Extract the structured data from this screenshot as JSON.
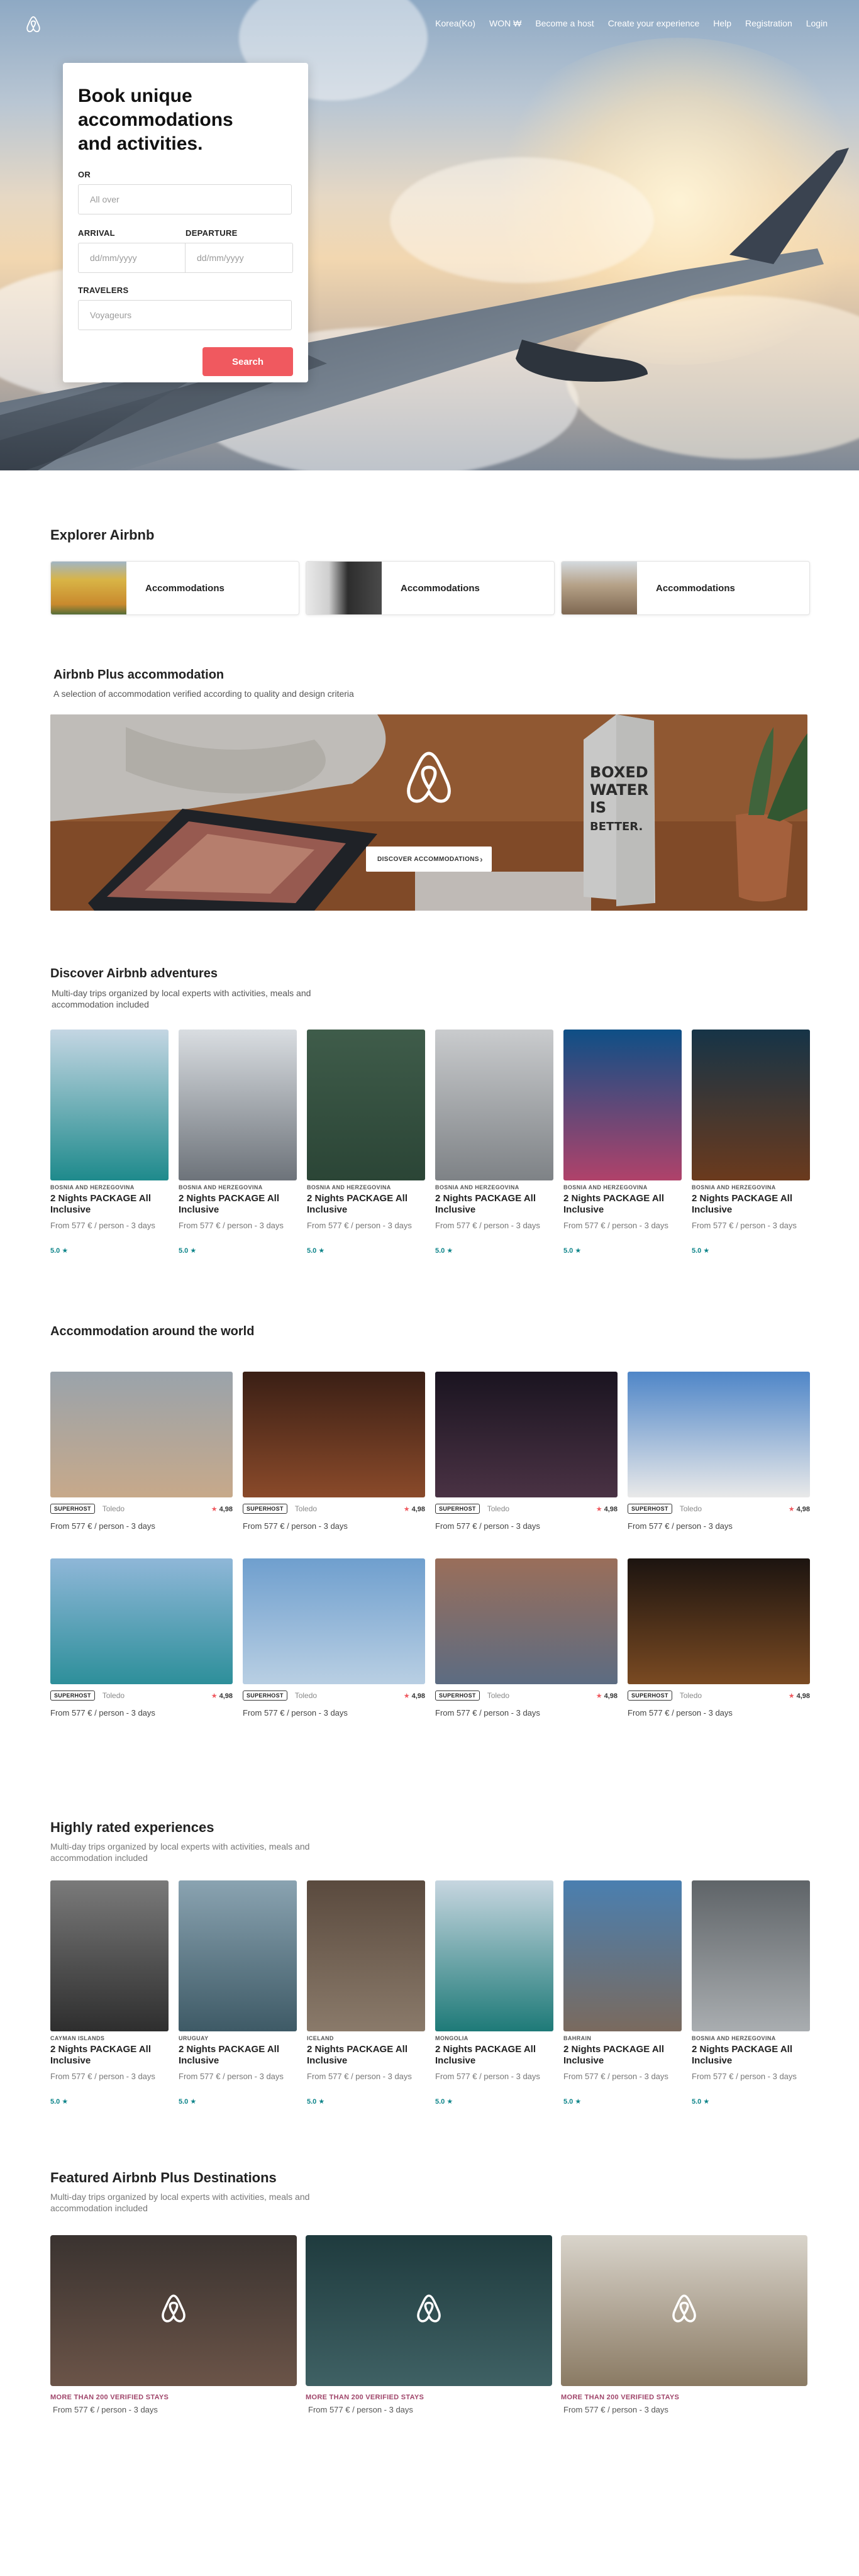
{
  "nav": {
    "language": "Korea(Ko)",
    "currency": "WON ₩",
    "links": [
      "Become a host",
      "Create your experience",
      "Help",
      "Registration",
      "Login"
    ]
  },
  "booking": {
    "title": "Book unique accommodations and activities.",
    "where_label": "OR",
    "where_placeholder": "All over",
    "arrival_label": "ARRIVAL",
    "departure_label": "DEPARTURE",
    "arrival_placeholder": "dd/mm/yyyy",
    "departure_placeholder": "dd/mm/yyyy",
    "travelers_label": "TRAVELERS",
    "travelers_placeholder": "Voyageurs",
    "search_label": "Search"
  },
  "explore": {
    "title": "Explorer Airbnb",
    "cards": [
      {
        "label": "Accommodations",
        "color": "#c9a84d"
      },
      {
        "label": "Accommodations",
        "color": "#3b3b3b"
      },
      {
        "label": "Accommodations",
        "color": "#a0856a"
      }
    ]
  },
  "plus": {
    "title": "Airbnb Plus accommodation",
    "subtitle": "A selection of accommodation verified according to quality and design criteria",
    "button": "DISCOVER ACCOMMODATIONS",
    "carton_text": [
      "BOXED",
      "WATER",
      "IS",
      "BETTER."
    ]
  },
  "adventures": {
    "title": "Discover Airbnb adventures",
    "subtitle": "Multi-day trips organized by local experts with activities, meals and accommodation included",
    "cards": [
      {
        "country": "BOSNIA AND HERZEGOVINA",
        "title": "2 Nights PACKAGE All Inclusive",
        "price": "From 577 € / person - 3 days",
        "rating": "5.0 ★",
        "top": "#c4d6e3",
        "bottom": "#1e8a8c"
      },
      {
        "country": "BOSNIA AND HERZEGOVINA",
        "title": "2 Nights PACKAGE All Inclusive",
        "price": "From 577 € / person - 3 days",
        "rating": "5.0 ★",
        "top": "#d9dde1",
        "bottom": "#6d737a"
      },
      {
        "country": "BOSNIA AND HERZEGOVINA",
        "title": "2 Nights PACKAGE All Inclusive",
        "price": "From 577 € / person - 3 days",
        "rating": "5.0 ★",
        "top": "#3f5c4a",
        "bottom": "#2b4536"
      },
      {
        "country": "BOSNIA AND HERZEGOVINA",
        "title": "2 Nights PACKAGE All Inclusive",
        "price": "From 577 € / person - 3 days",
        "rating": "5.0 ★",
        "top": "#c9cbcd",
        "bottom": "#7e8286"
      },
      {
        "country": "BOSNIA AND HERZEGOVINA",
        "title": "2 Nights PACKAGE All Inclusive",
        "price": "From 577 € / person - 3 days",
        "rating": "5.0 ★",
        "top": "#0e4f86",
        "bottom": "#b0426a"
      },
      {
        "country": "BOSNIA AND HERZEGOVINA",
        "title": "2 Nights PACKAGE All Inclusive",
        "price": "From 577 € / person - 3 days",
        "rating": "5.0 ★",
        "top": "#163447",
        "bottom": "#6b3a1d"
      }
    ]
  },
  "world": {
    "title": "Accommodation around the world",
    "cards": [
      {
        "badge": "SUPERHOST",
        "city": "Toledo",
        "score": "4,98",
        "price": "From 577 € / person - 3 days",
        "top": "#9aa3ab",
        "bottom": "#c7a98a"
      },
      {
        "badge": "SUPERHOST",
        "city": "Toledo",
        "score": "4,98",
        "price": "From 577 € / person - 3 days",
        "top": "#3a1f15",
        "bottom": "#8a4a2a"
      },
      {
        "badge": "SUPERHOST",
        "city": "Toledo",
        "score": "4,98",
        "price": "From 577 € / person - 3 days",
        "top": "#1a1420",
        "bottom": "#4a3244"
      },
      {
        "badge": "SUPERHOST",
        "city": "Toledo",
        "score": "4,98",
        "price": "From 577 € / person - 3 days",
        "top": "#4f86c8",
        "bottom": "#e9e9e9"
      },
      {
        "badge": "SUPERHOST",
        "city": "Toledo",
        "score": "4,98",
        "price": "From 577 € / person - 3 days",
        "top": "#8fb7d8",
        "bottom": "#2d8f9a"
      },
      {
        "badge": "SUPERHOST",
        "city": "Toledo",
        "score": "4,98",
        "price": "From 577 € / person - 3 days",
        "top": "#6f9fce",
        "bottom": "#b9cfe3"
      },
      {
        "badge": "SUPERHOST",
        "city": "Toledo",
        "score": "4,98",
        "price": "From 577 € / person - 3 days",
        "top": "#9a6e5a",
        "bottom": "#5c6c82"
      },
      {
        "badge": "SUPERHOST",
        "city": "Toledo",
        "score": "4,98",
        "price": "From 577 € / person - 3 days",
        "top": "#1c1410",
        "bottom": "#7a4a22"
      }
    ]
  },
  "experiences": {
    "title": "Highly rated experiences",
    "subtitle": "Multi-day trips organized by local experts with activities, meals and accommodation included",
    "cards": [
      {
        "country": "CAYMAN ISLANDS",
        "title": "2 Nights PACKAGE All Inclusive",
        "price": "From 577 € / person - 3 days",
        "rating": "5.0 ★",
        "top": "#7a7a7a",
        "bottom": "#2e2e2e"
      },
      {
        "country": "URUGUAY",
        "title": "2 Nights PACKAGE All Inclusive",
        "price": "From 577 € / person - 3 days",
        "rating": "5.0 ★",
        "top": "#8aa3b1",
        "bottom": "#3e5a66"
      },
      {
        "country": "ICELAND",
        "title": "2 Nights PACKAGE All Inclusive",
        "price": "From 577 € / person - 3 days",
        "rating": "5.0 ★",
        "top": "#5a4a3e",
        "bottom": "#8a7a6a"
      },
      {
        "country": "MONGOLIA",
        "title": "2 Nights PACKAGE All Inclusive",
        "price": "From 577 € / person - 3 days",
        "rating": "5.0 ★",
        "top": "#c7d6e0",
        "bottom": "#1e7a78"
      },
      {
        "country": "BAHRAIN",
        "title": "2 Nights PACKAGE All Inclusive",
        "price": "From 577 € / person - 3 days",
        "rating": "5.0 ★",
        "top": "#4a7fb0",
        "bottom": "#7a6a5e"
      },
      {
        "country": "BOSNIA AND HERZEGOVINA",
        "title": "2 Nights PACKAGE All Inclusive",
        "price": "From 577 € / person - 3 days",
        "rating": "5.0 ★",
        "top": "#5f6468",
        "bottom": "#a9adb0"
      }
    ]
  },
  "featured": {
    "title": "Featured Airbnb Plus Destinations",
    "subtitle": "Multi-day trips organized by local experts with activities, meals and accommodation included",
    "cards": [
      {
        "tag": "MORE THAN 200 VERIFIED STAYS",
        "price": "From 577 € / person - 3 days",
        "top": "#3a3330",
        "bottom": "#6b5448"
      },
      {
        "tag": "MORE THAN 200 VERIFIED STAYS",
        "price": "From 577 € / person - 3 days",
        "top": "#1f3b3e",
        "bottom": "#3f6164"
      },
      {
        "tag": "MORE THAN 200 VERIFIED STAYS",
        "price": "From 577 € / person - 3 days",
        "top": "#d9d4cb",
        "bottom": "#8a7a63"
      }
    ]
  },
  "colors": {
    "brand": "#f0595f",
    "rating": "#0c8489",
    "featured_tag": "#a0466b"
  }
}
